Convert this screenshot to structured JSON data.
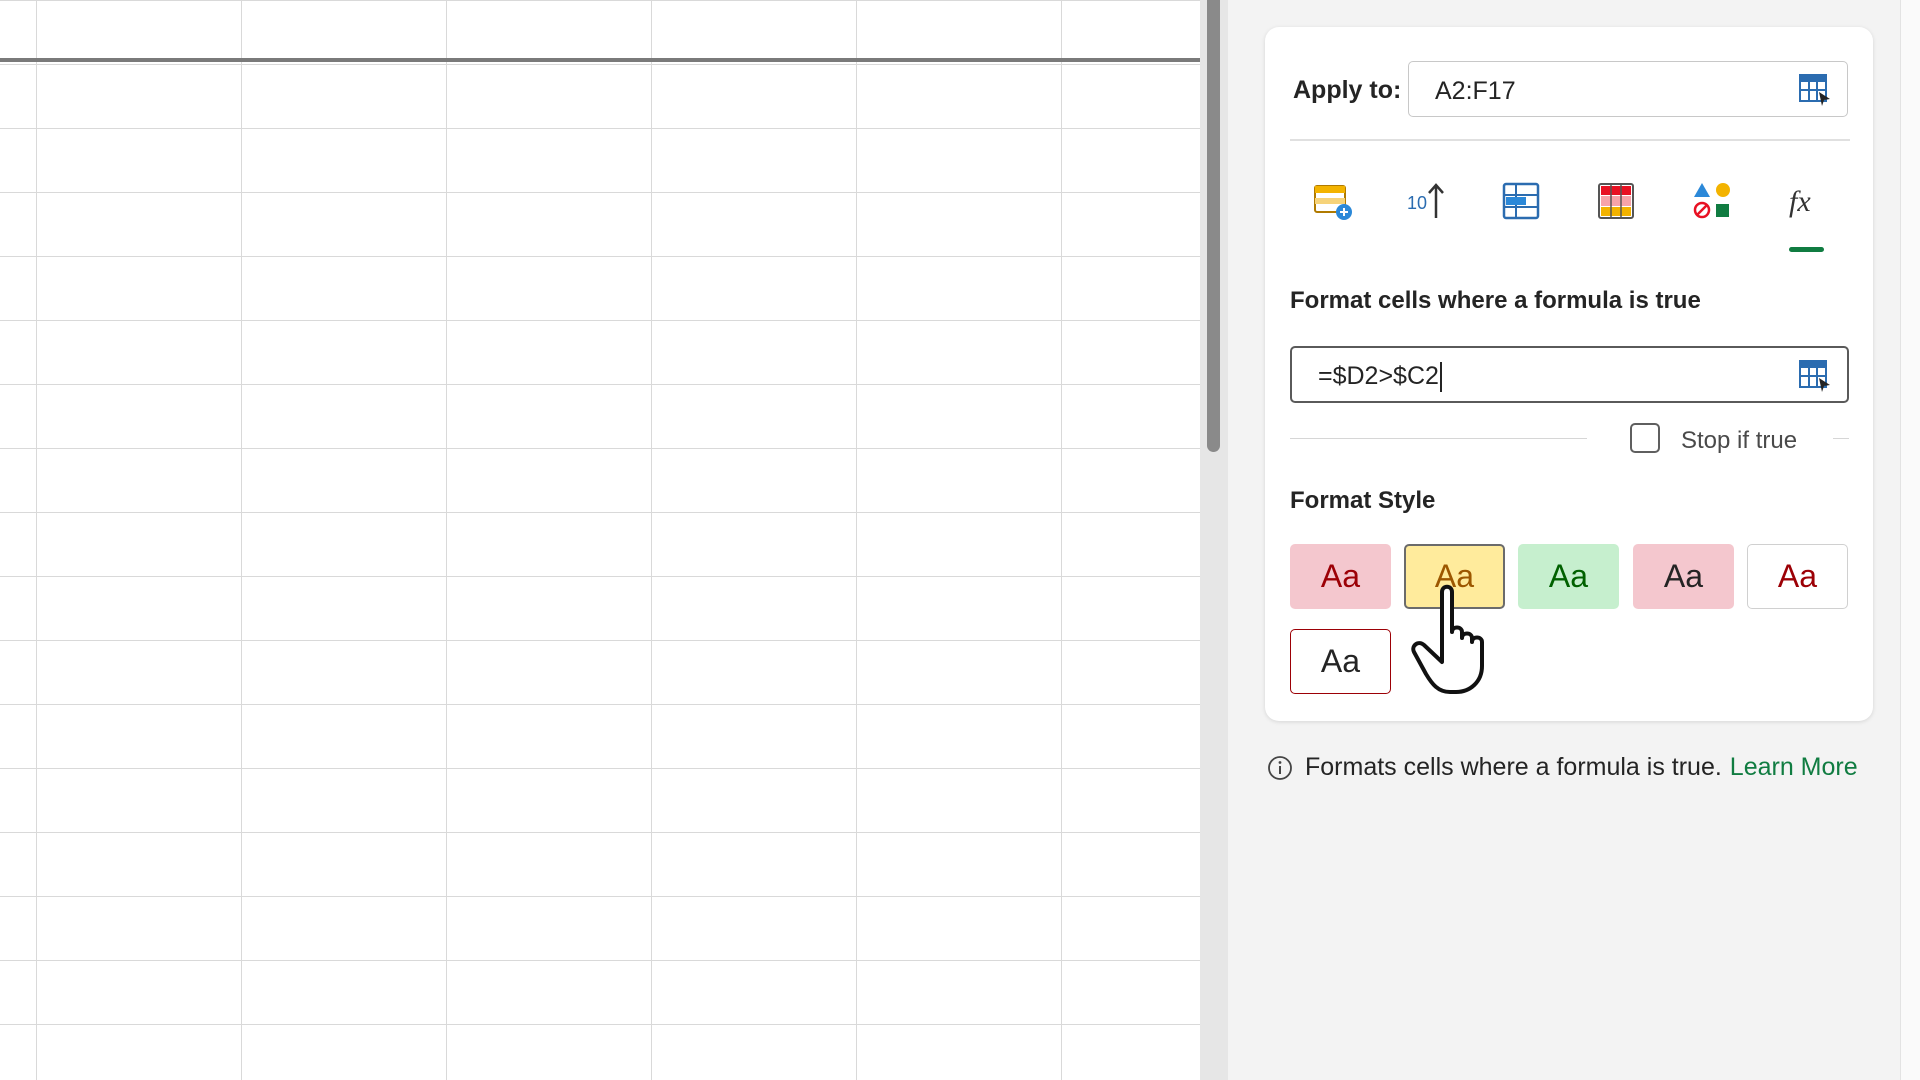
{
  "apply": {
    "label": "Apply to:",
    "range": "A2:F17"
  },
  "tabs": [
    {
      "icon": "highlight-cells-icon"
    },
    {
      "icon": "top-bottom-icon",
      "glyph": "10"
    },
    {
      "icon": "data-bars-icon"
    },
    {
      "icon": "color-scales-icon"
    },
    {
      "icon": "icon-sets-icon"
    },
    {
      "icon": "formula-icon",
      "glyph": "fx",
      "active": true
    }
  ],
  "formula": {
    "title": "Format cells where a formula is true",
    "value": "=$D2>$C2"
  },
  "stop": {
    "label": "Stop if true",
    "checked": false
  },
  "format_style": {
    "title": "Format Style",
    "swatches": [
      {
        "label": "Aa",
        "bg": "#f4c7ce",
        "fg": "#9c0006",
        "border": "#f4c7ce"
      },
      {
        "label": "Aa",
        "bg": "#ffeb9c",
        "fg": "#9c5700",
        "border": "#6b6b6b",
        "selected": true
      },
      {
        "label": "Aa",
        "bg": "#c6efce",
        "fg": "#006100",
        "border": "#c6efce"
      },
      {
        "label": "Aa",
        "bg": "#f4c7ce",
        "fg": "#242424",
        "border": "#f4c7ce"
      },
      {
        "label": "Aa",
        "bg": "#ffffff",
        "fg": "#9c0006",
        "border": "#d0d0d0"
      },
      {
        "label": "Aa",
        "bg": "#ffffff",
        "fg": "#242424",
        "border": "#9c0006"
      }
    ]
  },
  "info": {
    "text": "Formats cells where a formula is true.",
    "link": "Learn More"
  },
  "colors": {
    "accent": "#107c41"
  }
}
